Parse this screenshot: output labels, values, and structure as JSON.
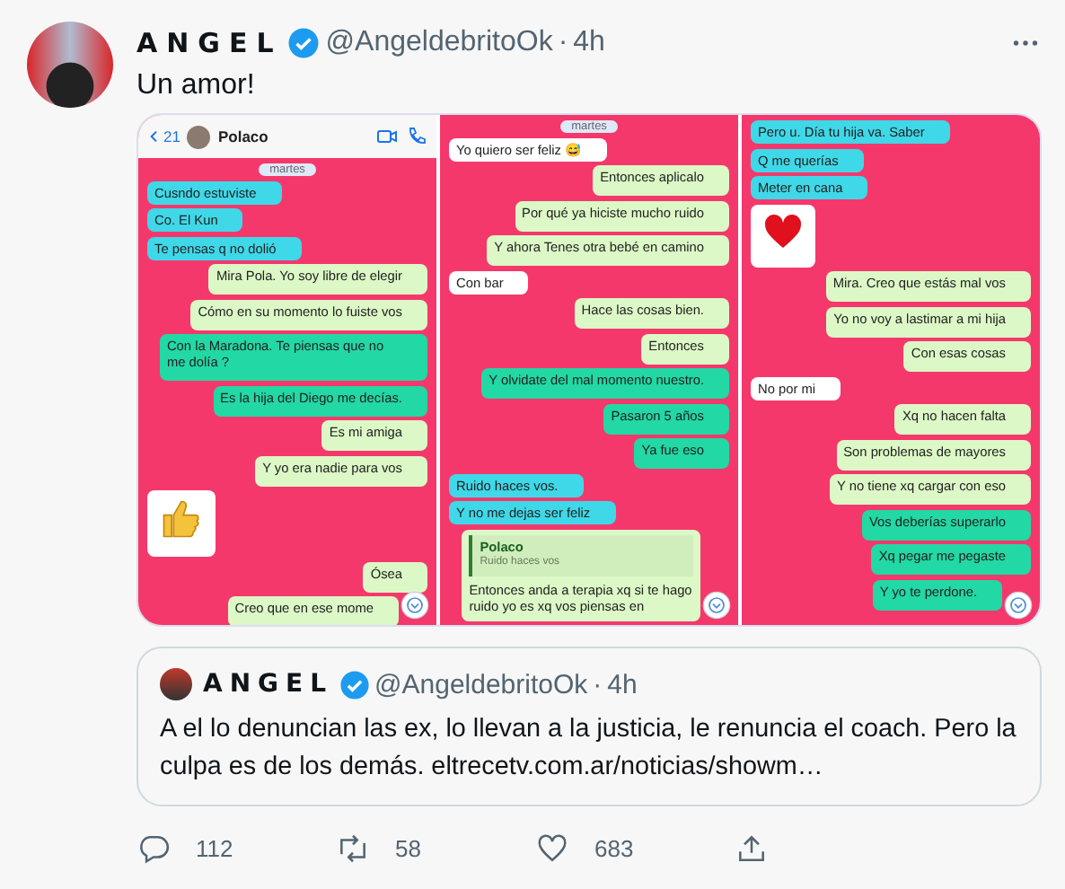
{
  "tweet": {
    "name": "ANGEL",
    "handle": "@AngeldebritoOk",
    "separator": "·",
    "time": "4h",
    "text": "Un amor!"
  },
  "chat_panels": [
    {
      "header": {
        "back_count": "21",
        "contact": "Polaco"
      },
      "messages": [
        {
          "kind": "date",
          "text": "martes"
        },
        {
          "kind": "in",
          "text": "Cusndo estuviste",
          "highlight": true
        },
        {
          "kind": "in",
          "text": "Co. El Kun",
          "highlight": true
        },
        {
          "kind": "in",
          "text": "Te pensas q no dolió",
          "highlight": true
        },
        {
          "kind": "out",
          "text": "Mira Pola. Yo soy libre de elegir",
          "highlight": false
        },
        {
          "kind": "out",
          "text": "Cómo en su momento lo fuiste vos",
          "highlight": false
        },
        {
          "kind": "out",
          "text": "Con la Maradona.  Te piensas que no me dolía ?",
          "highlight": true
        },
        {
          "kind": "out",
          "text": "Es la hija del Diego me decías.",
          "highlight": true
        },
        {
          "kind": "out",
          "text": "Es mi amiga",
          "highlight": false
        },
        {
          "kind": "out",
          "text": "Y yo era nadie para vos",
          "highlight": false
        },
        {
          "kind": "thumbs-up"
        },
        {
          "kind": "out",
          "text": "Ósea",
          "highlight": false
        },
        {
          "kind": "out",
          "text": "Creo que en ese mome",
          "highlight": false
        }
      ]
    },
    {
      "messages": [
        {
          "kind": "date",
          "text": "martes"
        },
        {
          "kind": "in",
          "text": "Yo quiero ser feliz 😅",
          "highlight": false
        },
        {
          "kind": "out",
          "text": "Entonces aplicalo",
          "highlight": false
        },
        {
          "kind": "out",
          "text": "Por qué ya hiciste mucho ruido",
          "highlight": false
        },
        {
          "kind": "out",
          "text": "Y ahora Tenes otra bebé en camino",
          "highlight": false
        },
        {
          "kind": "in",
          "text": "Con bar",
          "highlight": false
        },
        {
          "kind": "out",
          "text": "Hace las cosas bien.",
          "highlight": false
        },
        {
          "kind": "out",
          "text": "Entonces",
          "highlight": false
        },
        {
          "kind": "out",
          "text": "Y olvidate del mal momento nuestro.",
          "highlight": true
        },
        {
          "kind": "out",
          "text": "Pasaron 5 años",
          "highlight": true
        },
        {
          "kind": "out",
          "text": "Ya fue eso",
          "highlight": true
        },
        {
          "kind": "in",
          "text": "Ruido haces vos.",
          "highlight": true
        },
        {
          "kind": "in",
          "text": "Y no me dejas ser feliz",
          "highlight": true
        },
        {
          "kind": "reply",
          "quote_name": "Polaco",
          "quote_text": "Ruido haces vos",
          "text": "Entonces anda a terapia xq si te hago ruido yo es xq vos piensas en"
        }
      ]
    },
    {
      "messages": [
        {
          "kind": "in",
          "text": "Pero u. Día tu hija va. Saber",
          "highlight": true
        },
        {
          "kind": "in",
          "text": "Q me querías",
          "highlight": true
        },
        {
          "kind": "in",
          "text": "Meter en cana",
          "highlight": true
        },
        {
          "kind": "heart"
        },
        {
          "kind": "out",
          "text": "Mira. Creo que estás mal vos",
          "highlight": false
        },
        {
          "kind": "out",
          "text": "Yo no voy a lastimar a mi hija",
          "highlight": false
        },
        {
          "kind": "out",
          "text": "Con esas cosas",
          "highlight": false
        },
        {
          "kind": "in",
          "text": "No por mi",
          "highlight": false
        },
        {
          "kind": "out",
          "text": "Xq no hacen falta",
          "highlight": false
        },
        {
          "kind": "out",
          "text": "Son problemas de mayores",
          "highlight": false
        },
        {
          "kind": "out",
          "text": "Y no tiene xq cargar con eso",
          "highlight": false
        },
        {
          "kind": "out",
          "text": "Vos deberías superarlo",
          "highlight": true
        },
        {
          "kind": "out",
          "text": "Xq pegar me pegaste",
          "highlight": true
        },
        {
          "kind": "out",
          "text": "Y yo te perdone.",
          "highlight": true
        }
      ]
    }
  ],
  "quoted_tweet": {
    "name": "ANGEL",
    "handle": "@AngeldebritoOk",
    "separator": "·",
    "time": "4h",
    "text": "A el lo denuncian las ex, lo llevan a la justicia, le renuncia el coach. Pero la culpa es de los demás. eltrecetv.com.ar/noticias/showm…"
  },
  "actions": [
    {
      "kind": "reply",
      "count": "112"
    },
    {
      "kind": "retweet",
      "count": "58"
    },
    {
      "kind": "like",
      "count": "683"
    },
    {
      "kind": "share"
    }
  ]
}
